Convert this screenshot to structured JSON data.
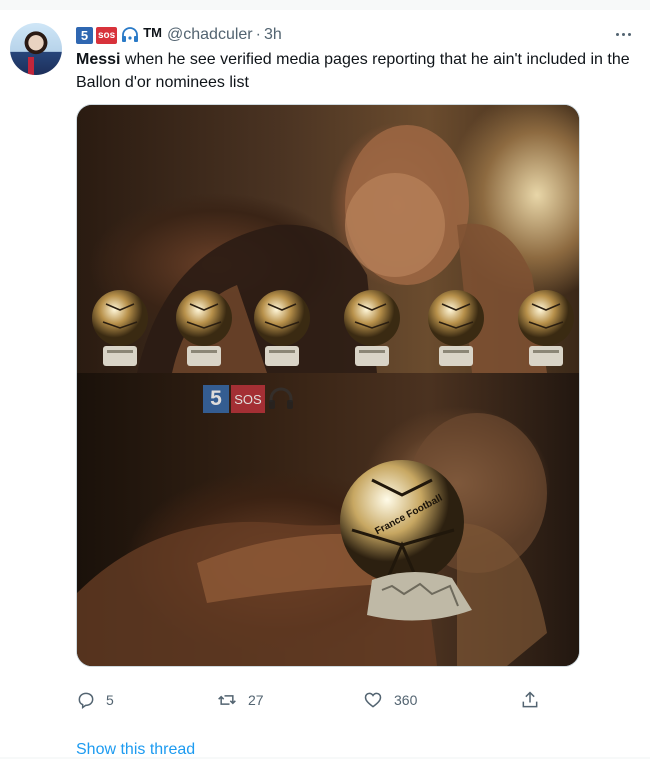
{
  "tweet": {
    "badge_number": "5",
    "badge_sos": "sos",
    "badge_tm": "TM",
    "handle": "@chadculer",
    "separator": "·",
    "time": "3h",
    "text_bold": "Messi",
    "text_rest": " when he see verified media pages reporting that he ain't included in the Ballon d'or nominees list",
    "image": {
      "watermark_number": "5",
      "watermark_sos": "SOS",
      "trophy_inscription": "France Football"
    },
    "metrics": {
      "replies": "5",
      "retweets": "27",
      "likes": "360"
    },
    "show_thread": "Show this thread"
  },
  "icons": {
    "reply": "reply-icon",
    "retweet": "retweet-icon",
    "like": "heart-icon",
    "share": "share-icon",
    "more": "more-icon",
    "headphones": "headphones-icon"
  },
  "colors": {
    "accent": "#1d9bf0",
    "muted": "#536471",
    "text": "#0f1419",
    "badge_blue": "#2f67b1",
    "badge_red": "#d8323b"
  }
}
